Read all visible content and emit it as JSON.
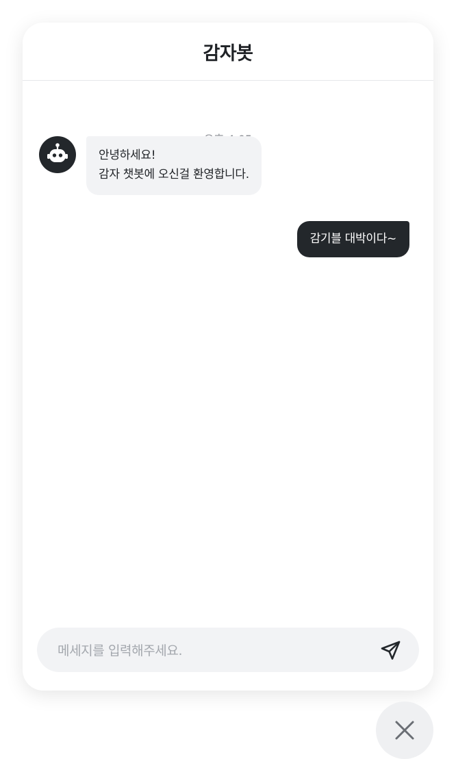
{
  "header": {
    "title": "감자봇"
  },
  "conversation": {
    "timestamp": "오후 4:05",
    "bot_message": {
      "avatar_icon": "robot-icon",
      "lines": [
        "안녕하세요!",
        "감자 챗봇에 오신걸 환영합니다."
      ]
    },
    "user_message": {
      "text": "감기블 대박이다~"
    }
  },
  "composer": {
    "placeholder": "메세지를 입력해주세요.",
    "value": "",
    "send_icon": "send-icon"
  },
  "close_button": {
    "icon": "close-icon"
  },
  "colors": {
    "dark": "#23272b",
    "bubble_light": "#f2f3f5",
    "muted_text": "#8a8d93",
    "placeholder": "#a3a7ad"
  }
}
